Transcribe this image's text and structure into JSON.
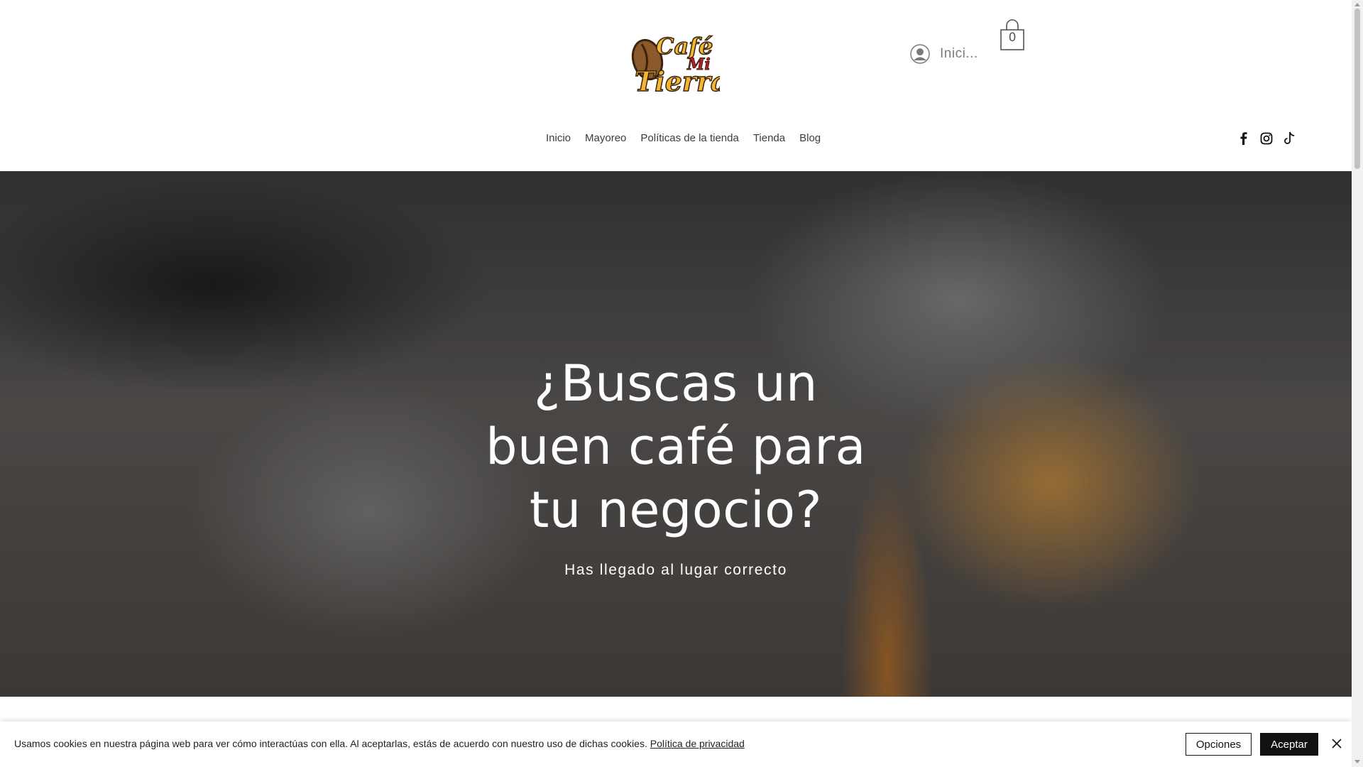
{
  "header": {
    "logo_text": "Café Mi Tierra",
    "login_label": "Inici...",
    "cart_count": "0"
  },
  "nav": {
    "items": [
      {
        "label": "Inicio"
      },
      {
        "label": "Mayoreo"
      },
      {
        "label": "Políticas de la tienda"
      },
      {
        "label": "Tienda"
      },
      {
        "label": "Blog"
      }
    ]
  },
  "social": {
    "icons": [
      "facebook-icon",
      "instagram-icon",
      "tiktok-icon"
    ]
  },
  "hero": {
    "title": "¿Buscas un buen café para tu negocio?",
    "subtitle": "Has llegado al lugar correcto"
  },
  "cookie": {
    "text": "Usamos cookies en nuestra página web para ver cómo interactúas con ella. Al aceptarlas, estás de acuerdo con nuestro uso de dichas cookies.",
    "link": "Política de privacidad",
    "options_label": "Opciones",
    "accept_label": "Aceptar"
  },
  "colors": {
    "logo_yellow": "#f2b630",
    "logo_red": "#c0172b",
    "logo_brown": "#6b3f1d",
    "button_dark": "#111111"
  }
}
